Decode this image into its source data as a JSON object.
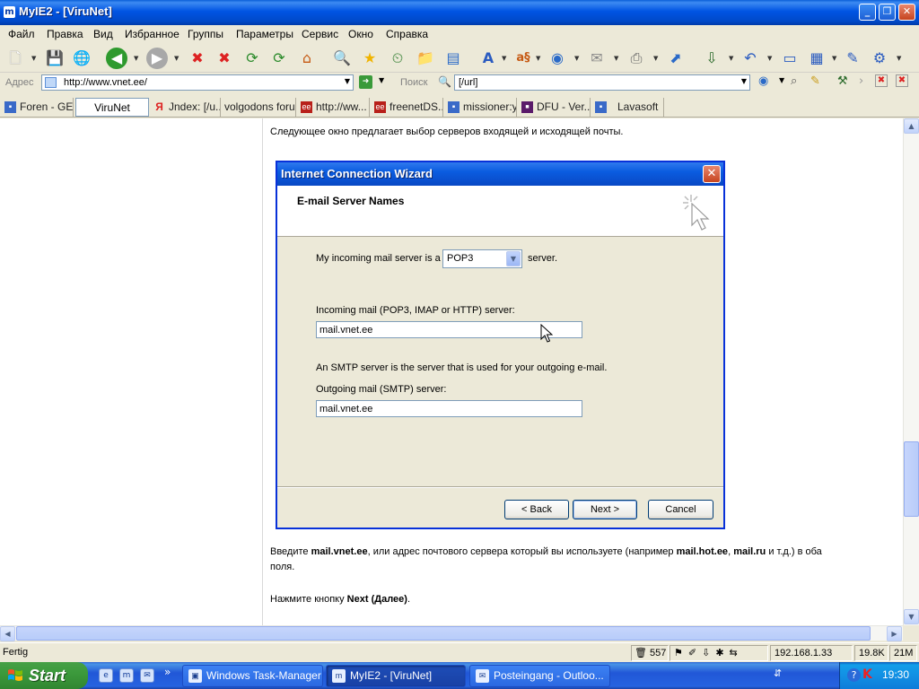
{
  "window": {
    "title": "MyIE2 - [ViruNet]"
  },
  "menu": [
    "Файл",
    "Правка",
    "Вид",
    "Избранное",
    "Группы",
    "Параметры",
    "Сервис",
    "Окно",
    "Справка"
  ],
  "address": {
    "label": "Адрес",
    "url": "http://www.vnet.ee/",
    "search_label": "Поиск",
    "search_value": "[/url]"
  },
  "tabs": [
    {
      "label": "Foren - GE...",
      "active": false
    },
    {
      "label": "ViruNet",
      "active": true
    },
    {
      "label": "Jndex: [/u...",
      "active": false
    },
    {
      "label": "volgodons forum",
      "active": false
    },
    {
      "label": "http://ww...",
      "active": false
    },
    {
      "label": "freenetDS...",
      "active": false
    },
    {
      "label": "missioner:y...",
      "active": false
    },
    {
      "label": "DFU - Ver...",
      "active": false
    },
    {
      "label": "Lavasoft",
      "active": false
    }
  ],
  "page": {
    "intro": "Следующее окно предлагает выбор серверов входящей и исходящей почты.",
    "para1_a": "Введите ",
    "para1_b": "mail.vnet.ee",
    "para1_c": ", или адрес почтового сервера который вы используете (например ",
    "para1_d": "mail.hot.ee",
    "para1_e": ", ",
    "para1_f": "mail.ru",
    "para1_g": " и т.д.) в оба",
    "para1_line2": "поля.",
    "para2_a": "Нажмите кнопку ",
    "para2_b": "Next (Далее)",
    "para2_c": "."
  },
  "wizard": {
    "title": "Internet Connection Wizard",
    "header": "E-mail Server Names",
    "incoming_prefix": "My incoming mail server is a",
    "server_type": "POP3",
    "incoming_suffix": "server.",
    "incoming_label": "Incoming mail (POP3, IMAP or HTTP) server:",
    "incoming_value": "mail.vnet.ee",
    "smtp_note": "An SMTP server is the server that is used for your outgoing e-mail.",
    "outgoing_label": "Outgoing mail (SMTP) server:",
    "outgoing_value": "mail.vnet.ee",
    "back": "< Back",
    "next": "Next >",
    "cancel": "Cancel"
  },
  "status": {
    "text": "Fertig",
    "count": "557",
    "ip": "192.168.1.33",
    "size": "19.8K",
    "mem": "21M"
  },
  "taskbar": {
    "start": "Start",
    "tasks": [
      {
        "label": "Windows Task-Manager",
        "active": false
      },
      {
        "label": "MyIE2 - [ViruNet]",
        "active": true
      },
      {
        "label": "Posteingang - Outloo...",
        "active": false
      }
    ],
    "clock": "19:30"
  }
}
